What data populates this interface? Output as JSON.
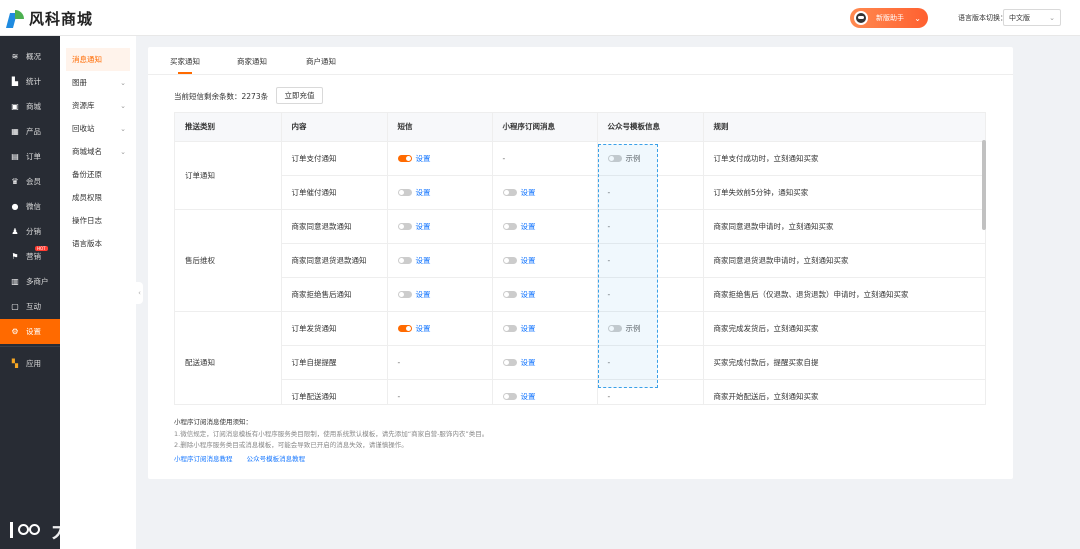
{
  "app": {
    "title": "风科商城"
  },
  "header": {
    "helper_label": "新版助手",
    "lang_label": "语言版本切换：",
    "lang_value": "中文版"
  },
  "sidebar": {
    "items": [
      {
        "label": "概况",
        "icon": "layers-icon"
      },
      {
        "label": "统计",
        "icon": "chart-icon"
      },
      {
        "label": "商城",
        "icon": "shop-icon"
      },
      {
        "label": "产品",
        "icon": "box-icon"
      },
      {
        "label": "订单",
        "icon": "order-icon"
      },
      {
        "label": "会员",
        "icon": "crown-icon"
      },
      {
        "label": "微信",
        "icon": "wechat-icon"
      },
      {
        "label": "分销",
        "icon": "users-icon"
      },
      {
        "label": "营销",
        "icon": "flag-icon",
        "badge": "HOT"
      },
      {
        "label": "多商户",
        "icon": "store-icon"
      },
      {
        "label": "互动",
        "icon": "chat-icon"
      },
      {
        "label": "设置",
        "icon": "gear-icon"
      },
      {
        "label": "应用",
        "icon": "apps-icon"
      }
    ]
  },
  "subnav": {
    "items": [
      {
        "label": "消息通知",
        "expandable": false
      },
      {
        "label": "图册",
        "expandable": true
      },
      {
        "label": "资源库",
        "expandable": true
      },
      {
        "label": "回收站",
        "expandable": true
      },
      {
        "label": "商城域名",
        "expandable": true
      },
      {
        "label": "备份还原",
        "expandable": false
      },
      {
        "label": "成员权限",
        "expandable": false
      },
      {
        "label": "操作日志",
        "expandable": false
      },
      {
        "label": "语言版本",
        "expandable": false
      }
    ]
  },
  "tabs": [
    "买家通知",
    "商家通知",
    "商户通知"
  ],
  "sms": {
    "info": "当前短信剩余条数：2273条",
    "recharge": "立即充值"
  },
  "table": {
    "headers": [
      "推送类别",
      "内容",
      "短信",
      "小程序订阅消息",
      "公众号模板信息",
      "规则"
    ],
    "set_label": "设置",
    "example_label": "示例",
    "groups": [
      {
        "category": "订单通知",
        "rows": [
          {
            "content": "订单支付通知",
            "sms": "on",
            "mini": "-",
            "mp": "example",
            "rule": "订单支付成功时，立刻通知买家"
          },
          {
            "content": "订单催付通知",
            "sms": "off",
            "mini": "off",
            "mp": "-",
            "rule": "订单失效前5分钟，通知买家"
          }
        ]
      },
      {
        "category": "售后维权",
        "rows": [
          {
            "content": "商家同意退款通知",
            "sms": "off",
            "mini": "off",
            "mp": "-",
            "rule": "商家同意退款申请时，立刻通知买家"
          },
          {
            "content": "商家同意退货退款通知",
            "sms": "off",
            "mini": "off",
            "mp": "-",
            "rule": "商家同意退货退款申请时，立刻通知买家"
          },
          {
            "content": "商家拒绝售后通知",
            "sms": "off",
            "mini": "off",
            "mp": "-",
            "rule": "商家拒绝售后（仅退款、退货退款）申请时，立刻通知买家"
          }
        ]
      },
      {
        "category": "配送通知",
        "rows": [
          {
            "content": "订单发货通知",
            "sms": "on",
            "mini": "off",
            "mp": "example",
            "rule": "商家完成发货后，立刻通知买家"
          },
          {
            "content": "订单自提提醒",
            "sms": "-",
            "mini": "off",
            "mp": "-",
            "rule": "买家完成付款后，提醒买家自提"
          },
          {
            "content": "订单配送通知",
            "sms": "-",
            "mini": "off",
            "mp": "-",
            "rule": "商家开始配送后，立刻通知买家"
          }
        ]
      }
    ]
  },
  "notes": {
    "title": "小程序订阅消息使用须知：",
    "line1": "1.微信规定，订阅消息模板有小程序服务类目限制，使用系统默认模板，请先添加“商家自营-服饰内衣”类目。",
    "line2": "2.删除小程序服务类目或消息模板，可能会导致已开启的消息失效，请谨慎操作。",
    "link1": "小程序订阅消息教程",
    "link2": "公众号模板消息教程"
  },
  "watermark": "大数跨境"
}
